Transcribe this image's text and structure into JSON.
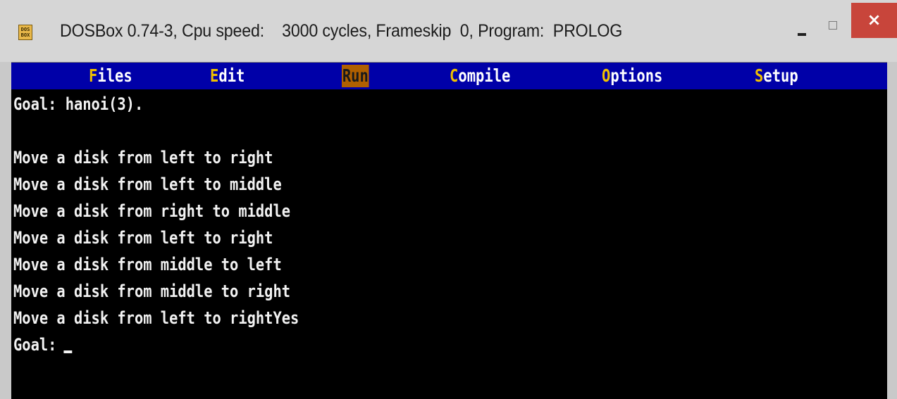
{
  "window": {
    "icon_label": "DOS BOX",
    "title": "DOSBox 0.74-3, Cpu speed:    3000 cycles, Frameskip  0, Program:  PROLOG",
    "close_label": "×"
  },
  "menu": {
    "files": {
      "hot": "F",
      "rest": "iles"
    },
    "edit": {
      "hot": "E",
      "rest": "dit"
    },
    "run": {
      "hot": "R",
      "rest": "un"
    },
    "compile": {
      "hot": "C",
      "rest": "ompile"
    },
    "options": {
      "hot": "O",
      "rest": "ptions"
    },
    "setup": {
      "hot": "S",
      "rest": "etup"
    }
  },
  "terminal": {
    "lines": [
      "Goal: hanoi(3).",
      "",
      "Move a disk from left to right",
      "Move a disk from left to middle",
      "Move a disk from right to middle",
      "Move a disk from left to right",
      "Move a disk from middle to left",
      "Move a disk from middle to right",
      "Move a disk from left to rightYes"
    ],
    "prompt": "Goal:"
  },
  "colors": {
    "menu_bg": "#0000a8",
    "menu_hotkey": "#f0c000",
    "menu_active_bg": "#b06000",
    "screen_bg": "#000000",
    "close_button": "#c8453b"
  }
}
